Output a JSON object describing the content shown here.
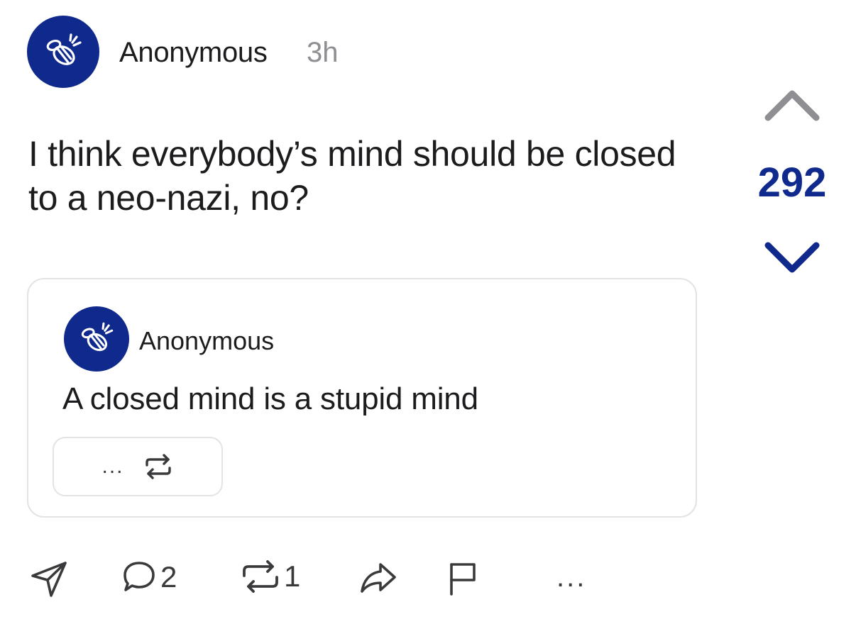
{
  "post": {
    "author": "Anonymous",
    "time": "3h",
    "text": "I think everybody’s mind should be closed to a neo-nazi, no?",
    "votes": "292",
    "avatar_icon": "bee-icon",
    "brand_color": "#0f2a8c"
  },
  "quoted": {
    "author": "Anonymous",
    "text": "A closed mind is a stupid mind",
    "more_label": "...",
    "repost_icon": "repost-icon"
  },
  "actions": {
    "send_icon": "send-icon",
    "comment_icon": "comment-icon",
    "comment_count": "2",
    "repost_icon": "repost-icon",
    "repost_count": "1",
    "share_icon": "share-icon",
    "flag_icon": "flag-icon",
    "more_label": "..."
  }
}
